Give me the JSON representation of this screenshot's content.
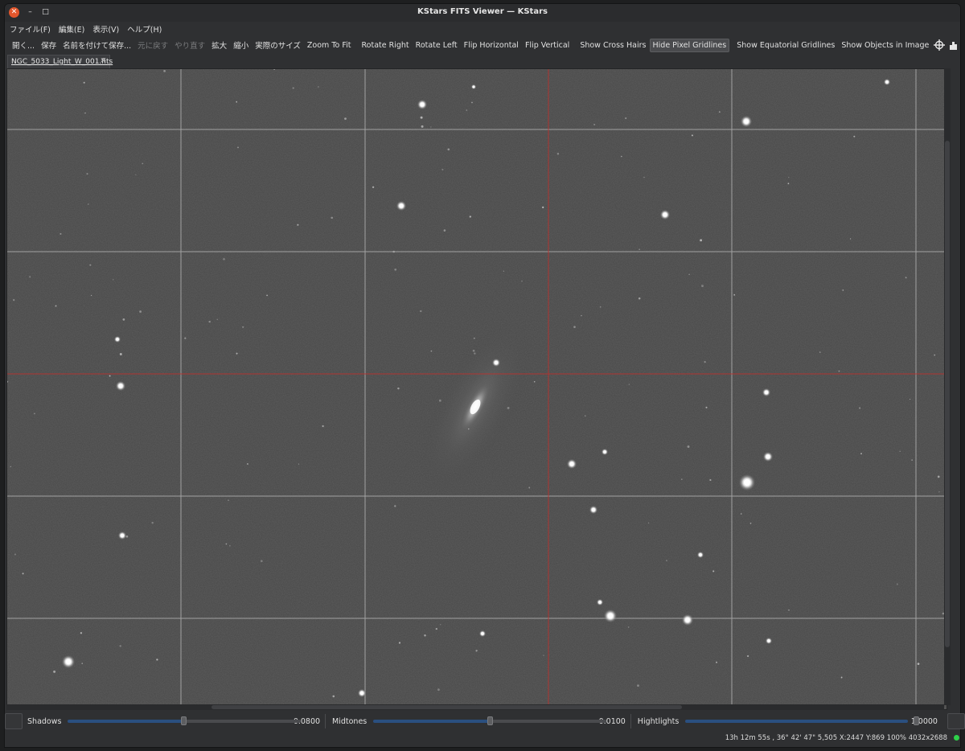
{
  "window": {
    "title": "KStars FITS Viewer — KStars"
  },
  "menu": [
    "ファイル(F)",
    "編集(E)",
    "表示(V)",
    "ヘルプ(H)"
  ],
  "toolbar": {
    "open": "開く...",
    "save": "保存",
    "save_as": "名前を付けて保存...",
    "undo": "元に戻す",
    "redo": "やり直す",
    "zoom_in": "拡大",
    "zoom_out": "縮小",
    "actual_size": "実際のサイズ",
    "zoom_fit": "Zoom To Fit",
    "rotate_right": "Rotate Right",
    "rotate_left": "Rotate Left",
    "flip_h": "Flip Horizontal",
    "flip_v": "Flip Vertical",
    "crosshairs": "Show Cross Hairs",
    "pixel_grid": "Hide Pixel Gridlines",
    "eq_grid": "Show Equatorial Gridlines",
    "objects": "Show Objects in Image",
    "stats": "統計"
  },
  "tab": {
    "label": "NGC_5033_Light_W_001.fits"
  },
  "sliders": {
    "shadows": {
      "label": "Shadows",
      "value": "0.0800",
      "fraction": 0.5
    },
    "midtones": {
      "label": "Midtones",
      "value": "0.0100",
      "fraction": 0.45
    },
    "highlights": {
      "label": "Hightlights",
      "value": "1.0000",
      "fraction": 0.99
    }
  },
  "status": {
    "text": "13h 12m 55s ,  36° 42' 47\"  5,505  X:2447 Y:869  100%  4032x2688",
    "led_color": "#2ed14a"
  },
  "colors": {
    "window_bg": "#2f3032",
    "image_bg": "#474747",
    "grid": "#bdbdbd",
    "crosshair": "#c0302c",
    "slider_accent": "#2a4f80"
  },
  "image": {
    "description_icon": "star-field"
  }
}
